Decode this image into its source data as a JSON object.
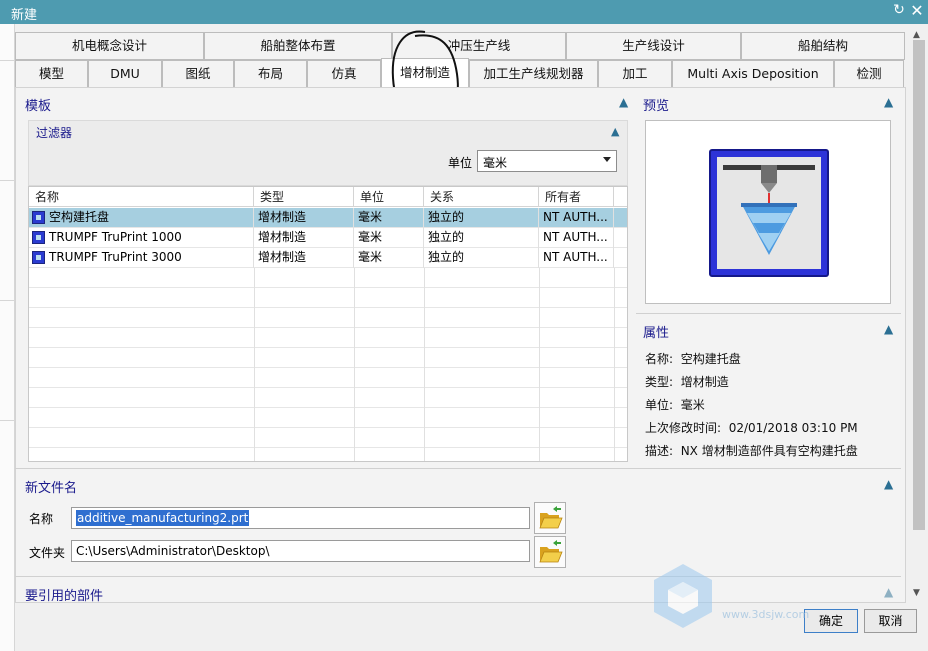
{
  "window": {
    "title": "新建",
    "restore_icon": "↻",
    "close_icon": "✕"
  },
  "tabs_row1": [
    "机电概念设计",
    "船舶整体布置",
    "冲压生产线",
    "生产线设计",
    "船舶结构"
  ],
  "tabs_row2": [
    "模型",
    "DMU",
    "图纸",
    "布局",
    "仿真",
    "增材制造",
    "加工生产线规划器",
    "加工",
    "Multi Axis Deposition",
    "检测"
  ],
  "active_tab": "增材制造",
  "templates": {
    "title": "模板",
    "filter": {
      "title": "过滤器",
      "unit_label": "单位",
      "unit_value": "毫米"
    },
    "columns": [
      "名称",
      "类型",
      "单位",
      "关系",
      "所有者"
    ],
    "rows": [
      {
        "name": "空构建托盘",
        "type": "增材制造",
        "unit": "毫米",
        "relation": "独立的",
        "owner": "NT AUTH...",
        "selected": true
      },
      {
        "name": "TRUMPF TruPrint 1000",
        "type": "增材制造",
        "unit": "毫米",
        "relation": "独立的",
        "owner": "NT AUTH...",
        "selected": false
      },
      {
        "name": "TRUMPF TruPrint 3000",
        "type": "增材制造",
        "unit": "毫米",
        "relation": "独立的",
        "owner": "NT AUTH...",
        "selected": false
      }
    ]
  },
  "preview": {
    "title": "预览"
  },
  "properties": {
    "title": "属性",
    "name_label": "名称:",
    "name_value": "空构建托盘",
    "type_label": "类型:",
    "type_value": "增材制造",
    "unit_label": "单位:",
    "unit_value": "毫米",
    "modified_label": "上次修改时间:",
    "modified_value": "02/01/2018 03:10 PM",
    "desc_label": "描述:",
    "desc_value": "NX 增材制造部件具有空构建托盘"
  },
  "new_file": {
    "title": "新文件名",
    "name_label": "名称",
    "name_value": "additive_manufacturing2.prt",
    "folder_label": "文件夹",
    "folder_value": "C:\\Users\\Administrator\\Desktop\\"
  },
  "referenced_parts": {
    "title": "要引用的部件"
  },
  "buttons": {
    "ok": "确定",
    "cancel": "取消"
  },
  "watermark": "www.3dsjw.com",
  "colors": {
    "titlebar": "#4e9bb0",
    "selection": "#a6cfe0",
    "section_title": "#1a1a8c",
    "icon_blue": "#2d33d8"
  }
}
